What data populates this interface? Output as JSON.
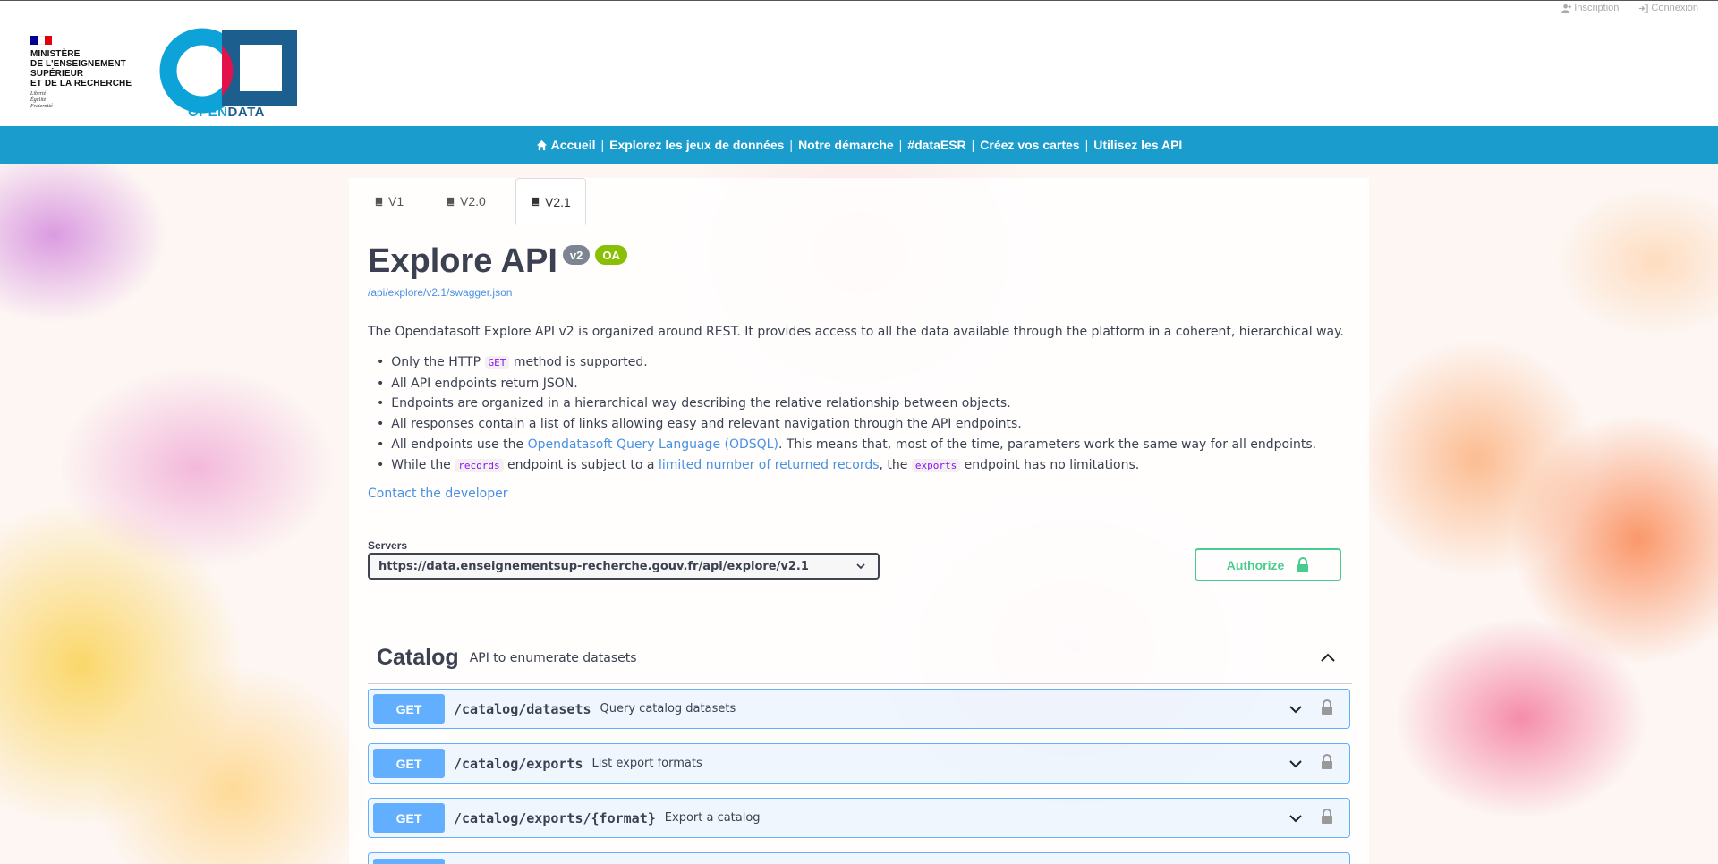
{
  "auth_links": {
    "signup": "Inscription",
    "login": "Connexion"
  },
  "header": {
    "ministry_lines": [
      "MINISTÈRE",
      "DE L'ENSEIGNEMENT",
      "SUPÉRIEUR",
      "ET DE LA RECHERCHE"
    ],
    "motto": [
      "Liberté",
      "Égalité",
      "Fraternité"
    ],
    "opendata_a": "OPEN",
    "opendata_b": "DATA"
  },
  "nav": {
    "items": [
      "Accueil",
      "Explorez les jeux de données",
      "Notre démarche",
      "#dataESR",
      "Créez vos cartes",
      "Utilisez les API"
    ],
    "separator": "|"
  },
  "tabs": [
    "V1",
    "V2.0",
    "V2.1"
  ],
  "active_tab": "V2.1",
  "api": {
    "title": "Explore API",
    "version_badge": "v2",
    "oas_badge": "OA",
    "spec_url": "/api/explore/v2.1/swagger.json",
    "intro": "The Opendatasoft Explore API v2 is organized around REST. It provides access to all the data available through the platform in a coherent, hierarchical way.",
    "bullets": {
      "b1_pre": "Only the HTTP ",
      "b1_code": "GET",
      "b1_post": " method is supported.",
      "b2": "All API endpoints return JSON.",
      "b3": "Endpoints are organized in a hierarchical way describing the relative relationship between objects.",
      "b4": "All responses contain a list of links allowing easy and relevant navigation through the API endpoints.",
      "b5_pre": "All endpoints use the ",
      "b5_link": "Opendatasoft Query Language (ODSQL)",
      "b5_post": ". This means that, most of the time, parameters work the same way for all endpoints.",
      "b6_pre": "While the ",
      "b6_code1": "records",
      "b6_mid": " endpoint is subject to a ",
      "b6_link": "limited number of returned records",
      "b6_mid2": ", the ",
      "b6_code2": "exports",
      "b6_post": " endpoint has no limitations."
    },
    "contact": "Contact the developer"
  },
  "servers": {
    "label": "Servers",
    "selected": "https://data.enseignementsup-recherche.gouv.fr/api/explore/v2.1"
  },
  "authorize_label": "Authorize",
  "catalog": {
    "name": "Catalog",
    "description": "API to enumerate datasets",
    "operations": [
      {
        "method": "GET",
        "path": "/catalog/datasets",
        "summary": "Query catalog datasets"
      },
      {
        "method": "GET",
        "path": "/catalog/exports",
        "summary": "List export formats"
      },
      {
        "method": "GET",
        "path": "/catalog/exports/{format}",
        "summary": "Export a catalog"
      }
    ]
  },
  "colors": {
    "nav": "#1a9ccc",
    "get": "#61affe",
    "authorize": "#49cc90",
    "link": "#4990e2",
    "code": "#9012fe"
  },
  "icons": [
    "user-plus-icon",
    "sign-in-icon",
    "home-icon",
    "book-icon",
    "chevron-down-icon",
    "lock-icon",
    "chevron-up-icon"
  ]
}
